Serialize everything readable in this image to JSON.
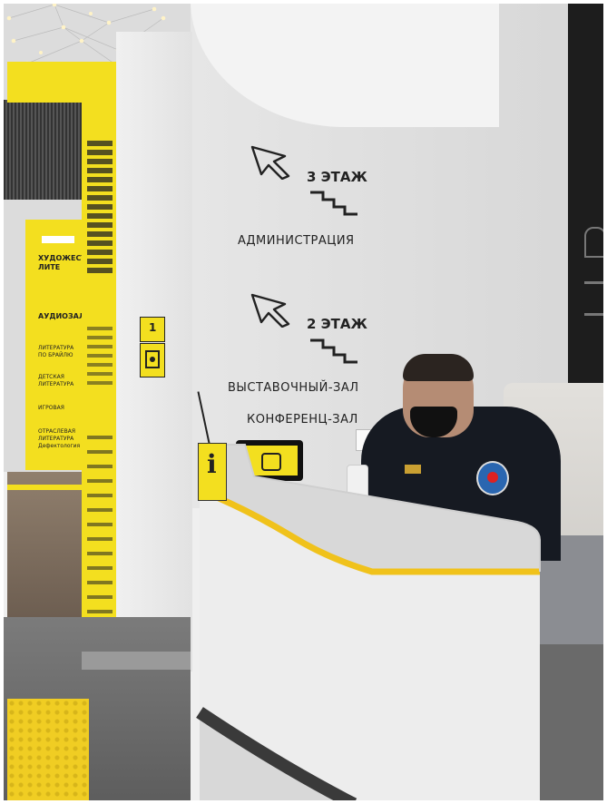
{
  "scene": {
    "floor3_label": "3 ЭТАЖ",
    "floor3_dest": "АДМИНИСТРАЦИЯ",
    "floor2_label": "2 ЭТАЖ",
    "floor2_dest1": "ВЫСТАВОЧНЫЙ-ЗАЛ",
    "floor2_dest2": "КОНФЕРЕНЦ-ЗАЛ",
    "left_sign": {
      "heading_partial": "ХУДОЖЕСТ\nЛИТЕ",
      "item1": "АУДИОЗАЛ",
      "item2": "ЛИТЕРАТУРА\nПО БРАЙЛЮ",
      "item3": "ДЕТСКАЯ\nЛИТЕРАТУРА",
      "item4": "ИГРОВАЯ",
      "item5": "ОТРАСЛЕВАЯ\nЛИТЕРАТУРА\nДефектология"
    },
    "floor_badge": "1",
    "info_icon": "i",
    "colors": {
      "yellow": "#f3df1f",
      "wall": "#e9e9e9",
      "wall_dark": "#d7d7d7",
      "floor": "#6f6f6f",
      "wood": "#8c7a67",
      "black": "#1b1b1b"
    }
  }
}
